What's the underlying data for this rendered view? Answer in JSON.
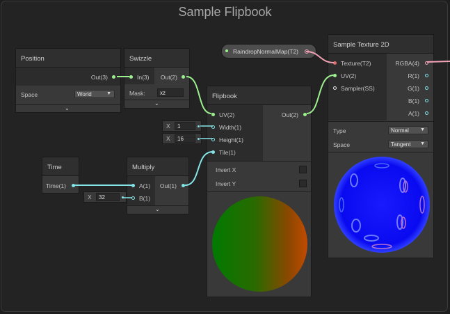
{
  "group": {
    "title": "Sample Flipbook"
  },
  "position": {
    "title": "Position",
    "out": "Out(3)",
    "space_label": "Space",
    "space_value": "World"
  },
  "swizzle": {
    "title": "Swizzle",
    "in": "In(3)",
    "out": "Out(2)",
    "mask_label": "Mask:",
    "mask_value": "xz"
  },
  "property": {
    "label": "RaindropNormalMap(T2)"
  },
  "flipbook": {
    "title": "Flipbook",
    "inputs": {
      "uv": "UV(2)",
      "width": "Width(1)",
      "height": "Height(1)",
      "tile": "Tile(1)"
    },
    "out": "Out(2)",
    "invert_x": "Invert X",
    "invert_y": "Invert Y"
  },
  "inline_width": {
    "x": "X",
    "value": "1"
  },
  "inline_height": {
    "x": "X",
    "value": "16"
  },
  "inline_b": {
    "x": "X",
    "value": "32"
  },
  "time": {
    "title": "Time",
    "out": "Time(1)"
  },
  "multiply": {
    "title": "Multiply",
    "a": "A(1)",
    "b": "B(1)",
    "out": "Out(1)"
  },
  "sample": {
    "title": "Sample Texture 2D",
    "inputs": {
      "texture": "Texture(T2)",
      "uv": "UV(2)",
      "sampler": "Sampler(SS)"
    },
    "outputs": {
      "rgba": "RGBA(4)",
      "r": "R(1)",
      "g": "G(1)",
      "b": "B(1)",
      "a": "A(1)"
    },
    "type_label": "Type",
    "type_value": "Normal",
    "space_label": "Space",
    "space_value": "Tangent"
  },
  "colors": {
    "vector": "#9df08e",
    "float": "#84e4e7",
    "texture": "#f2a3b6"
  }
}
